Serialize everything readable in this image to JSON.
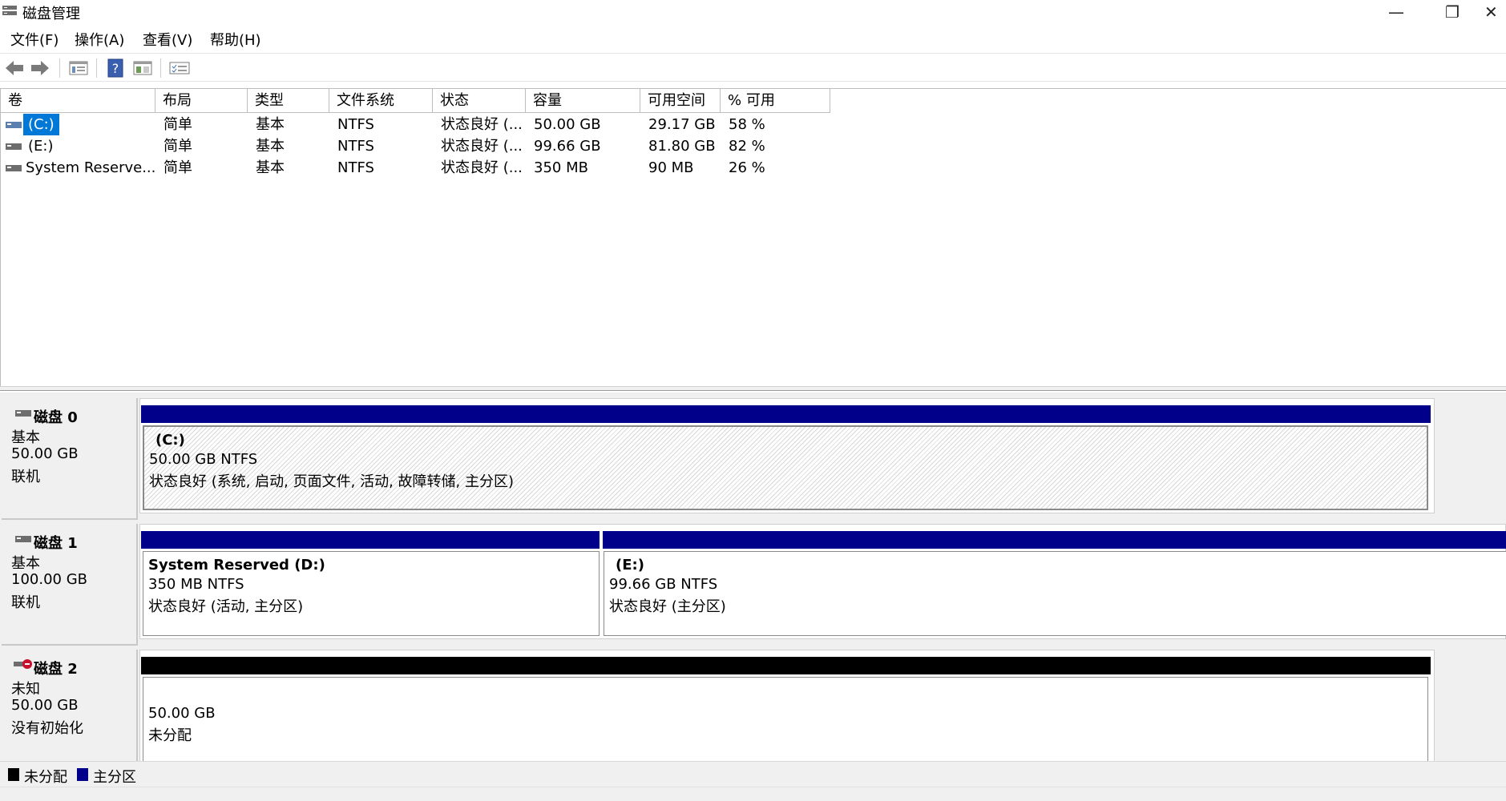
{
  "window": {
    "title": "磁盘管理",
    "minimize_glyph": "—",
    "restore_glyph": "❐",
    "close_glyph": "✕"
  },
  "menu": [
    "文件(F)",
    "操作(A)",
    "查看(V)",
    "帮助(H)"
  ],
  "toolbar": {
    "buttons": [
      "back-arrow-icon",
      "forward-arrow-icon",
      "disk-list-icon",
      "help-icon",
      "properties-icon",
      "checklist-icon"
    ]
  },
  "volume_table": {
    "columns": [
      "卷",
      "布局",
      "类型",
      "文件系统",
      "状态",
      "容量",
      "可用空间",
      "% 可用"
    ],
    "rows": [
      {
        "volume": "(C:)",
        "layout": "简单",
        "type": "基本",
        "fs": "NTFS",
        "status": "状态良好 (...",
        "capacity": "50.00 GB",
        "free": "29.17 GB",
        "pct": "58 %",
        "selected": true
      },
      {
        "volume": "(E:)",
        "layout": "简单",
        "type": "基本",
        "fs": "NTFS",
        "status": "状态良好 (...",
        "capacity": "99.66 GB",
        "free": "81.80 GB",
        "pct": "82 %",
        "selected": false
      },
      {
        "volume": "System Reserve...",
        "layout": "简单",
        "type": "基本",
        "fs": "NTFS",
        "status": "状态良好 (...",
        "capacity": "350 MB",
        "free": "90 MB",
        "pct": "26 %",
        "selected": false
      }
    ]
  },
  "disks": [
    {
      "name": "磁盘 0",
      "kind": "基本",
      "size": "50.00 GB",
      "state": "联机",
      "partitions": [
        {
          "label": "(C:)",
          "size_fs": "50.00 GB NTFS",
          "status": "状态良好 (系统, 启动, 页面文件, 活动, 故障转储, 主分区)"
        }
      ]
    },
    {
      "name": "磁盘 1",
      "kind": "基本",
      "size": "100.00 GB",
      "state": "联机",
      "partitions": [
        {
          "label": "System Reserved  (D:)",
          "size_fs": "350 MB NTFS",
          "status": "状态良好 (活动, 主分区)"
        },
        {
          "label": "(E:)",
          "size_fs": "99.66 GB NTFS",
          "status": "状态良好 (主分区)"
        }
      ]
    },
    {
      "name": "磁盘 2",
      "kind": "未知",
      "size": "50.00 GB",
      "state": "没有初始化",
      "partitions": [
        {
          "size_fs": "50.00 GB",
          "status": "未分配"
        }
      ]
    }
  ],
  "legend": [
    {
      "label": "未分配",
      "color": "#000000"
    },
    {
      "label": "主分区",
      "color": "#00008b"
    }
  ],
  "colors": {
    "primary_partition": "#00008b",
    "unallocated": "#000000",
    "selection": "#0078d7"
  }
}
